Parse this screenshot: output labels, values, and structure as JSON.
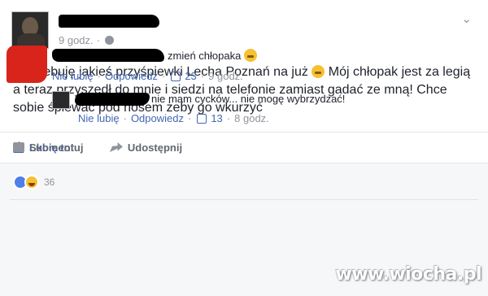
{
  "post": {
    "time": "9 godz.",
    "text_before_emoji": "Potrzebuję jakieś przyśpiewki Lecha Poznań na już",
    "text_after_emoji": " Mój chłopak jest za legią a teraz przyszedł do mnie i siedzi na telefonie zamiast gadać ze mną! Chce sobie śpiewać pod nosem żeby go wkurzyć",
    "emoji_icon": "grinning-face-icon"
  },
  "actions": {
    "like_label": "Lubię to!",
    "comment_label": "Skomentuj",
    "share_label": "Udostępnij"
  },
  "reactions": {
    "count": "36"
  },
  "comments": [
    {
      "text": "zmień chłopaka",
      "unlike_label": "Nie lubię",
      "reply_label": "Odpowiedz",
      "likes": "23",
      "time": "9 godz."
    },
    {
      "text": "nie mam cycków... nie mogę wybrzydzać!",
      "unlike_label": "Nie lubię",
      "reply_label": "Odpowiedz",
      "likes": "13",
      "time": "8 godz."
    }
  ],
  "watermark": "www.wiocha.pl",
  "colors": {
    "accent": "#4267b2",
    "muted": "#90949c",
    "comments_bg": "#f6f7f9"
  }
}
